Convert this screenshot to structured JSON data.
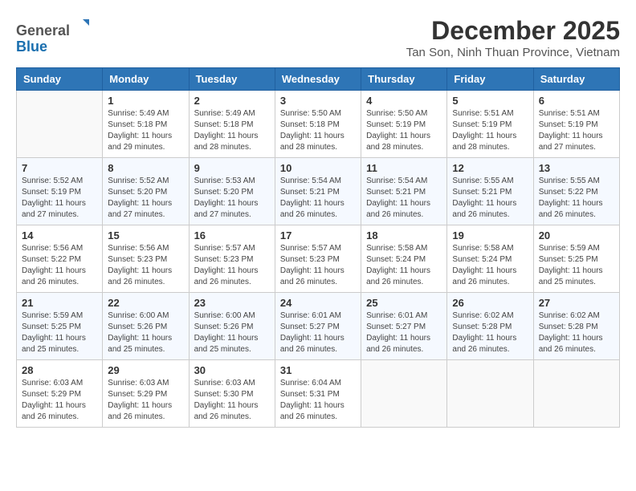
{
  "header": {
    "logo": {
      "line1": "General",
      "line2": "Blue"
    },
    "title": "December 2025",
    "subtitle": "Tan Son, Ninh Thuan Province, Vietnam"
  },
  "weekdays": [
    "Sunday",
    "Monday",
    "Tuesday",
    "Wednesday",
    "Thursday",
    "Friday",
    "Saturday"
  ],
  "weeks": [
    [
      {
        "day": "",
        "info": ""
      },
      {
        "day": "1",
        "info": "Sunrise: 5:49 AM\nSunset: 5:18 PM\nDaylight: 11 hours\nand 29 minutes."
      },
      {
        "day": "2",
        "info": "Sunrise: 5:49 AM\nSunset: 5:18 PM\nDaylight: 11 hours\nand 28 minutes."
      },
      {
        "day": "3",
        "info": "Sunrise: 5:50 AM\nSunset: 5:18 PM\nDaylight: 11 hours\nand 28 minutes."
      },
      {
        "day": "4",
        "info": "Sunrise: 5:50 AM\nSunset: 5:19 PM\nDaylight: 11 hours\nand 28 minutes."
      },
      {
        "day": "5",
        "info": "Sunrise: 5:51 AM\nSunset: 5:19 PM\nDaylight: 11 hours\nand 28 minutes."
      },
      {
        "day": "6",
        "info": "Sunrise: 5:51 AM\nSunset: 5:19 PM\nDaylight: 11 hours\nand 27 minutes."
      }
    ],
    [
      {
        "day": "7",
        "info": "Sunrise: 5:52 AM\nSunset: 5:19 PM\nDaylight: 11 hours\nand 27 minutes."
      },
      {
        "day": "8",
        "info": "Sunrise: 5:52 AM\nSunset: 5:20 PM\nDaylight: 11 hours\nand 27 minutes."
      },
      {
        "day": "9",
        "info": "Sunrise: 5:53 AM\nSunset: 5:20 PM\nDaylight: 11 hours\nand 27 minutes."
      },
      {
        "day": "10",
        "info": "Sunrise: 5:54 AM\nSunset: 5:21 PM\nDaylight: 11 hours\nand 26 minutes."
      },
      {
        "day": "11",
        "info": "Sunrise: 5:54 AM\nSunset: 5:21 PM\nDaylight: 11 hours\nand 26 minutes."
      },
      {
        "day": "12",
        "info": "Sunrise: 5:55 AM\nSunset: 5:21 PM\nDaylight: 11 hours\nand 26 minutes."
      },
      {
        "day": "13",
        "info": "Sunrise: 5:55 AM\nSunset: 5:22 PM\nDaylight: 11 hours\nand 26 minutes."
      }
    ],
    [
      {
        "day": "14",
        "info": "Sunrise: 5:56 AM\nSunset: 5:22 PM\nDaylight: 11 hours\nand 26 minutes."
      },
      {
        "day": "15",
        "info": "Sunrise: 5:56 AM\nSunset: 5:23 PM\nDaylight: 11 hours\nand 26 minutes."
      },
      {
        "day": "16",
        "info": "Sunrise: 5:57 AM\nSunset: 5:23 PM\nDaylight: 11 hours\nand 26 minutes."
      },
      {
        "day": "17",
        "info": "Sunrise: 5:57 AM\nSunset: 5:23 PM\nDaylight: 11 hours\nand 26 minutes."
      },
      {
        "day": "18",
        "info": "Sunrise: 5:58 AM\nSunset: 5:24 PM\nDaylight: 11 hours\nand 26 minutes."
      },
      {
        "day": "19",
        "info": "Sunrise: 5:58 AM\nSunset: 5:24 PM\nDaylight: 11 hours\nand 26 minutes."
      },
      {
        "day": "20",
        "info": "Sunrise: 5:59 AM\nSunset: 5:25 PM\nDaylight: 11 hours\nand 25 minutes."
      }
    ],
    [
      {
        "day": "21",
        "info": "Sunrise: 5:59 AM\nSunset: 5:25 PM\nDaylight: 11 hours\nand 25 minutes."
      },
      {
        "day": "22",
        "info": "Sunrise: 6:00 AM\nSunset: 5:26 PM\nDaylight: 11 hours\nand 25 minutes."
      },
      {
        "day": "23",
        "info": "Sunrise: 6:00 AM\nSunset: 5:26 PM\nDaylight: 11 hours\nand 25 minutes."
      },
      {
        "day": "24",
        "info": "Sunrise: 6:01 AM\nSunset: 5:27 PM\nDaylight: 11 hours\nand 26 minutes."
      },
      {
        "day": "25",
        "info": "Sunrise: 6:01 AM\nSunset: 5:27 PM\nDaylight: 11 hours\nand 26 minutes."
      },
      {
        "day": "26",
        "info": "Sunrise: 6:02 AM\nSunset: 5:28 PM\nDaylight: 11 hours\nand 26 minutes."
      },
      {
        "day": "27",
        "info": "Sunrise: 6:02 AM\nSunset: 5:28 PM\nDaylight: 11 hours\nand 26 minutes."
      }
    ],
    [
      {
        "day": "28",
        "info": "Sunrise: 6:03 AM\nSunset: 5:29 PM\nDaylight: 11 hours\nand 26 minutes."
      },
      {
        "day": "29",
        "info": "Sunrise: 6:03 AM\nSunset: 5:29 PM\nDaylight: 11 hours\nand 26 minutes."
      },
      {
        "day": "30",
        "info": "Sunrise: 6:03 AM\nSunset: 5:30 PM\nDaylight: 11 hours\nand 26 minutes."
      },
      {
        "day": "31",
        "info": "Sunrise: 6:04 AM\nSunset: 5:31 PM\nDaylight: 11 hours\nand 26 minutes."
      },
      {
        "day": "",
        "info": ""
      },
      {
        "day": "",
        "info": ""
      },
      {
        "day": "",
        "info": ""
      }
    ]
  ]
}
